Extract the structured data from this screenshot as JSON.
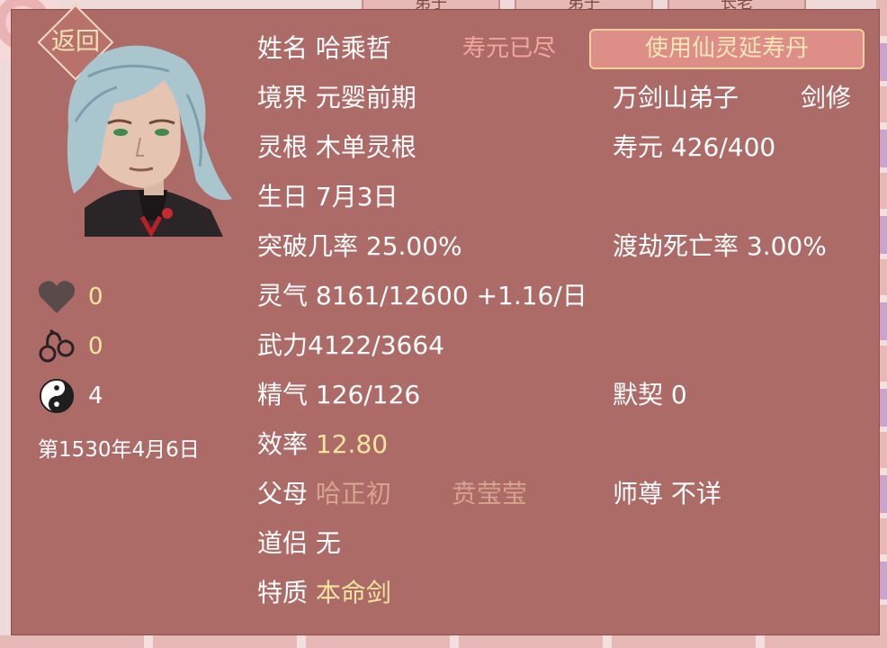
{
  "back_label": "返回",
  "use_pill_label": "使用仙灵延寿丹",
  "lifespan_status": "寿元已尽",
  "background_cards": [
    "弟子",
    "弟子",
    "长老"
  ],
  "left_stats": [
    {
      "icon": "heart-icon",
      "value": "0"
    },
    {
      "icon": "handcuffs-icon",
      "value": "0"
    },
    {
      "icon": "yin-yang-icon",
      "value": "4"
    }
  ],
  "date": "第1530年4月6日",
  "rows": [
    {
      "label": "姓名",
      "value": "哈乘哲"
    },
    {
      "label": "境界",
      "value": "元婴前期"
    },
    {
      "label": "灵根",
      "value": "木单灵根"
    },
    {
      "label": "生日",
      "value": "7月3日"
    },
    {
      "text": "突破几率 25.00%"
    },
    {
      "text": "灵气 8161/12600 +1.16/日"
    },
    {
      "text": "武力4122/3664"
    },
    {
      "text": "精气 126/126"
    },
    {
      "label": "效率",
      "value": "12.80"
    },
    {
      "label": "父母",
      "father": "哈正初",
      "mother": "贲莹莹"
    },
    {
      "label": "道侣",
      "value": "无"
    },
    {
      "label": "特质",
      "value": "本命剑"
    }
  ],
  "right_col": {
    "sect": "万剑山弟子",
    "class": "剑修",
    "lifespan": "寿元 426/400",
    "tribulation": "渡劫死亡率 3.00%",
    "bond": "默契 0",
    "master": "师尊 不详"
  }
}
